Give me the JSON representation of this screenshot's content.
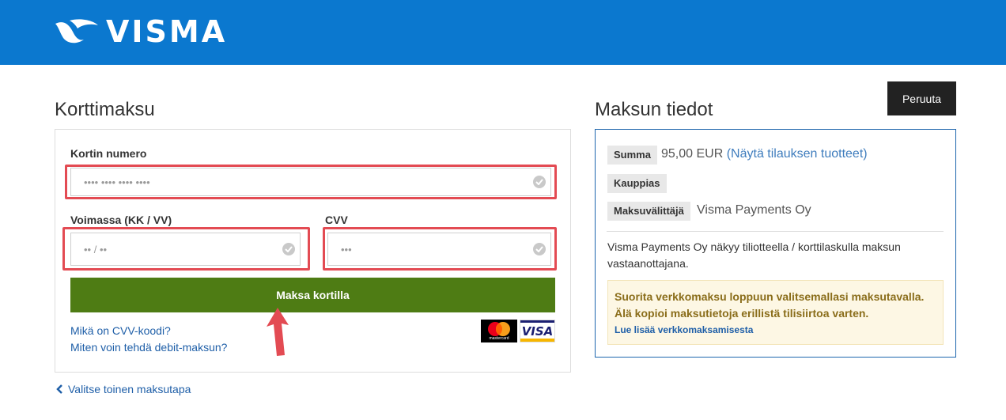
{
  "header": {
    "brand": "VISMA",
    "brand_color": "#0b78cf"
  },
  "left": {
    "title": "Korttimaksu",
    "card_number_label": "Kortin numero",
    "card_number_placeholder": "•••• •••• •••• ••••",
    "expiry_label": "Voimassa (KK / VV)",
    "expiry_placeholder": "•• / ••",
    "cvv_label": "CVV",
    "cvv_placeholder": "•••",
    "pay_button": "Maksa kortilla",
    "pay_button_color": "#4e7c14",
    "link_cvv": "Mikä on CVV-koodi?",
    "link_debit": "Miten voin tehdä debit-maksun?",
    "mastercard_text": "mastercard",
    "visa_text": "VISA",
    "back_link": "Valitse toinen maksutapa"
  },
  "right": {
    "title": "Maksun tiedot",
    "cancel_button": "Peruuta",
    "rows": [
      {
        "tag": "Summa",
        "value": "95,00 EUR",
        "link": "(Näytä tilauksen tuotteet)"
      },
      {
        "tag": "Kauppias",
        "value": ""
      },
      {
        "tag": "Maksuvälittäjä",
        "value": "Visma Payments Oy"
      }
    ],
    "note": "Visma Payments Oy näkyy tiliotteella / korttilaskulla maksun vastaanottajana.",
    "warning": "Suorita verkkomaksu loppuun valitsemallasi maksutavalla. Älä kopioi maksutietoja erillistä tilisiirtoa varten.",
    "warning_link": "Lue lisää verkkomaksamisesta"
  }
}
